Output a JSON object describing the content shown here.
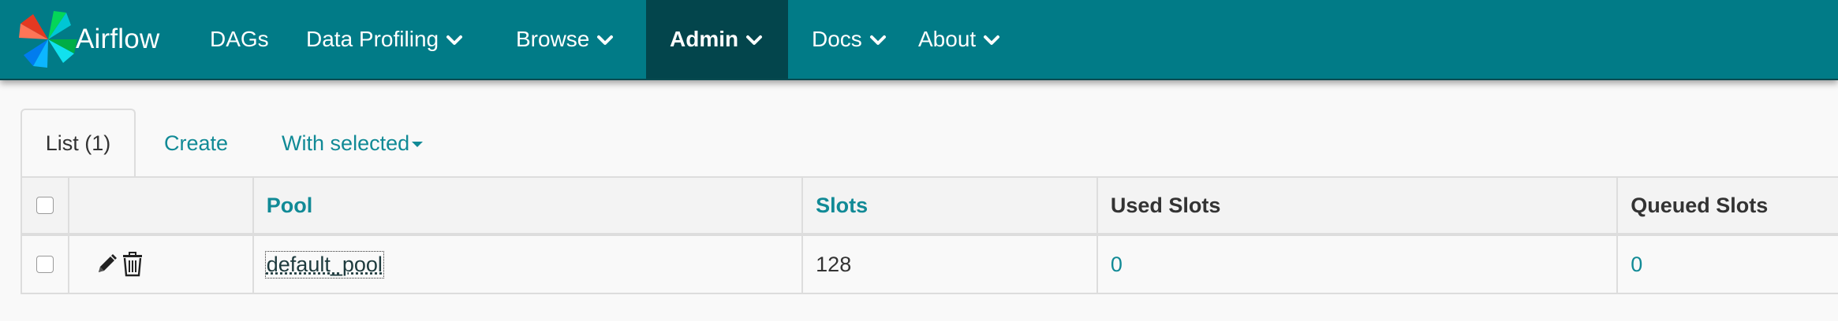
{
  "navbar": {
    "brand": "Airflow",
    "items": [
      {
        "label": "DAGs",
        "dropdown": false
      },
      {
        "label": "Data Profiling",
        "dropdown": true
      },
      {
        "label": "Browse",
        "dropdown": true
      },
      {
        "label": "Admin",
        "dropdown": true,
        "active": true
      },
      {
        "label": "Docs",
        "dropdown": true
      },
      {
        "label": "About",
        "dropdown": true
      }
    ],
    "background": "#017b87",
    "active_background": "#03454c"
  },
  "tabs": {
    "list": "List (1)",
    "create": "Create",
    "with_selected": "With selected"
  },
  "table": {
    "columns": [
      "Pool",
      "Slots",
      "Used Slots",
      "Queued Slots"
    ],
    "rows": [
      {
        "actions": [
          "pencil-icon",
          "trash-icon"
        ],
        "pool": "default_pool",
        "slots": "128",
        "used_slots": "0",
        "queued_slots": "0"
      }
    ]
  },
  "colors": {
    "link": "#118a96",
    "text": "#333333",
    "border": "#dddddd"
  }
}
